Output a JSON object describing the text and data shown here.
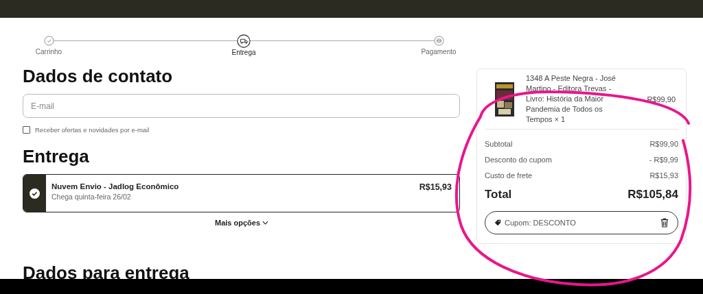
{
  "steps": [
    {
      "label": "Carrinho",
      "kind": "done"
    },
    {
      "label": "Entrega",
      "kind": "current"
    },
    {
      "label": "Pagamento",
      "kind": "todo"
    }
  ],
  "contact": {
    "heading": "Dados de contato",
    "email": {
      "placeholder": "E-mail"
    },
    "newsletter": {
      "label": "Receber ofertas e novidades por e-mail",
      "checked": false
    }
  },
  "delivery": {
    "heading": "Entrega",
    "options": [
      {
        "name": "Nuvem Envio - Jadlog Econômico",
        "eta": "Chega quinta-feira 26/02",
        "price": "R$15,93",
        "selected": true
      }
    ],
    "more": "Mais opções"
  },
  "address": {
    "heading": "Dados para entrega"
  },
  "summary": {
    "item": {
      "title": "1348 A Peste Negra - José Martino - Editora Trevas - Livro: História da Maior Pandemia de Todos os Tempos × 1",
      "price": "R$99,90"
    },
    "lines": [
      {
        "label": "Subtotal",
        "value": "R$99,90"
      },
      {
        "label": "Desconto do cupom",
        "value": "- R$9,99"
      },
      {
        "label": "Custo de frete",
        "value": "R$15,93"
      }
    ],
    "total": {
      "label": "Total",
      "value": "R$105,84"
    },
    "coupon": "Cupom: DESCONTO"
  },
  "annotations": [
    {
      "kind": "loop"
    }
  ]
}
